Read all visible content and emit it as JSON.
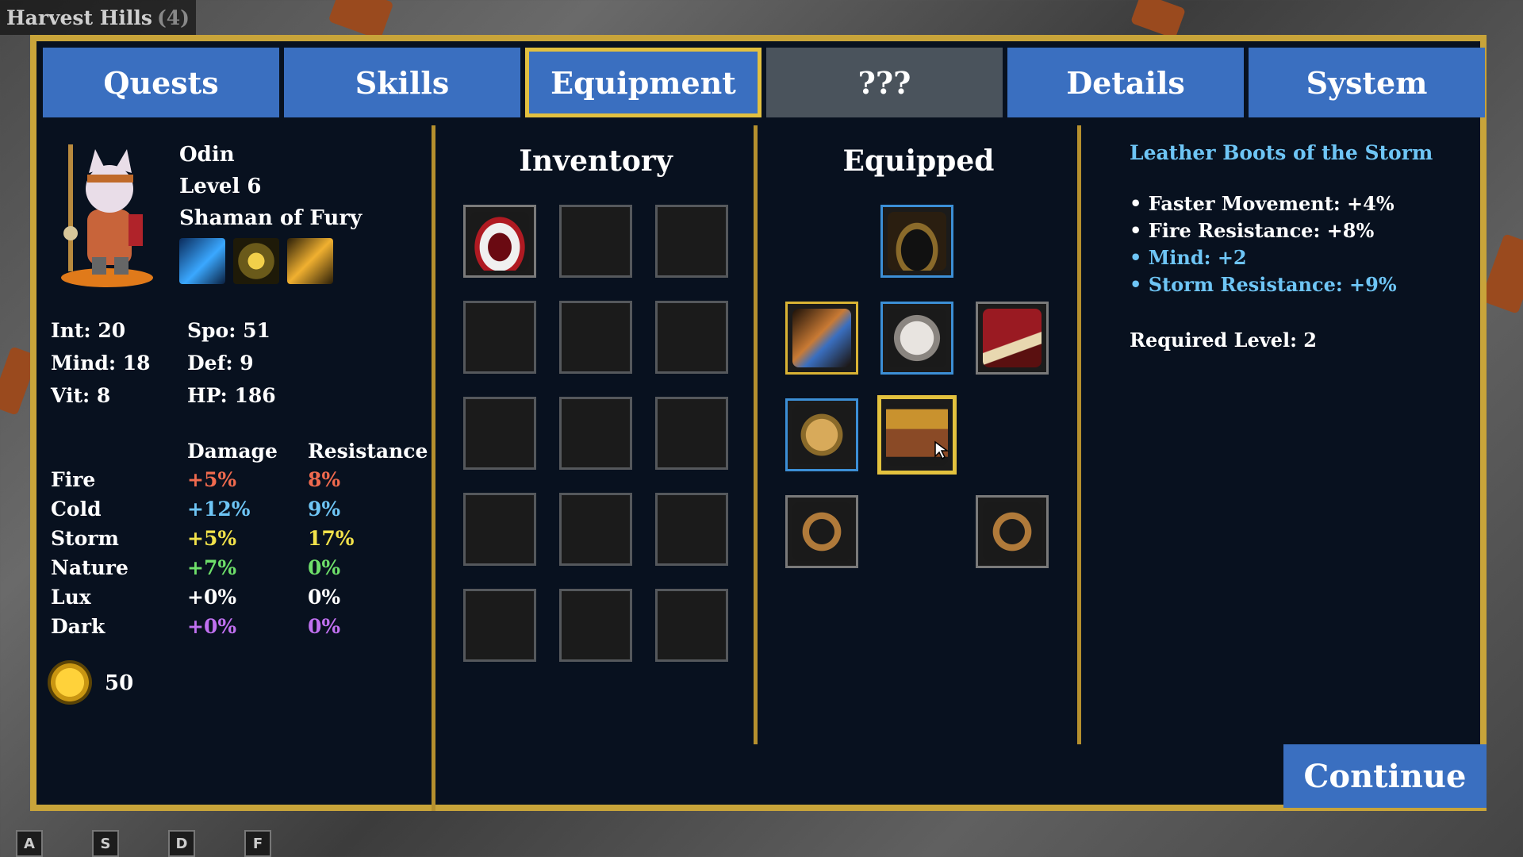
{
  "location": {
    "name": "Harvest Hills",
    "count": "(4)"
  },
  "hotkeys": [
    "A",
    "S",
    "D",
    "F"
  ],
  "tabs": [
    {
      "label": "Quests",
      "state": "normal"
    },
    {
      "label": "Skills",
      "state": "normal"
    },
    {
      "label": "Equipment",
      "state": "active"
    },
    {
      "label": "???",
      "state": "locked"
    },
    {
      "label": "Details",
      "state": "normal"
    },
    {
      "label": "System",
      "state": "normal"
    }
  ],
  "character": {
    "name": "Odin",
    "level": "Level 6",
    "class": "Shaman of Fury",
    "abilities": [
      "ice-shard-icon",
      "totem-icon",
      "lightning-icon"
    ]
  },
  "stats": {
    "int": "Int: 20",
    "mind": "Mind: 18",
    "vit": "Vit: 8",
    "spo": "Spo: 51",
    "def": "Def: 9",
    "hp": "HP: 186"
  },
  "elements": {
    "damage_header": "Damage",
    "resistance_header": "Resistance",
    "rows": [
      {
        "name": "Fire",
        "damage": "+5%",
        "resistance": "8%",
        "color": "#f06a4e"
      },
      {
        "name": "Cold",
        "damage": "+12%",
        "resistance": "9%",
        "color": "#6ec5f5"
      },
      {
        "name": "Storm",
        "damage": "+5%",
        "resistance": "17%",
        "color": "#f2e24a"
      },
      {
        "name": "Nature",
        "damage": "+7%",
        "resistance": "0%",
        "color": "#6ee06a"
      },
      {
        "name": "Lux",
        "damage": "+0%",
        "resistance": "0%",
        "color": "#ffffff"
      },
      {
        "name": "Dark",
        "damage": "+0%",
        "resistance": "0%",
        "color": "#c070f0"
      }
    ]
  },
  "gold": "50",
  "inventory": {
    "title": "Inventory",
    "items": [
      "jester-hat-icon",
      "",
      "",
      "",
      "",
      "",
      "",
      "",
      "",
      "",
      "",
      "",
      "",
      "",
      ""
    ]
  },
  "equipped": {
    "title": "Equipped",
    "slots": [
      {
        "slot": "head",
        "item": "hood-icon",
        "border": "blue"
      },
      {
        "slot": "weapon",
        "item": "horn-icon",
        "border": "gold"
      },
      {
        "slot": "body",
        "item": "shirt-icon",
        "border": "blue"
      },
      {
        "slot": "offhand",
        "item": "book-icon",
        "border": "grey"
      },
      {
        "slot": "hands",
        "item": "gloves-icon",
        "border": "blue"
      },
      {
        "slot": "feet",
        "item": "boots-icon",
        "border": "gold-selected"
      },
      {
        "slot": "ring-left",
        "item": "ring-icon",
        "border": "grey"
      },
      {
        "slot": "ring-right",
        "item": "ring-icon",
        "border": "grey"
      }
    ]
  },
  "item_detail": {
    "name": "Leather Boots of the Storm",
    "bonuses": [
      {
        "text": "• Faster Movement: +4%",
        "color": "#ffffff"
      },
      {
        "text": "• Fire Resistance: +8%",
        "color": "#ffffff"
      },
      {
        "text": "• Mind: +2",
        "color": "#6ec5f5"
      },
      {
        "text": "• Storm Resistance: +9%",
        "color": "#6ec5f5"
      }
    ],
    "required_level": "Required Level: 2"
  },
  "continue_label": "Continue"
}
